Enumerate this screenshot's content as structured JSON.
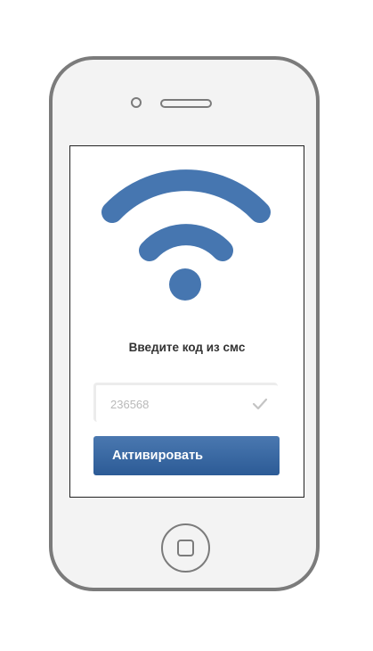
{
  "screen": {
    "prompt": "Введите код из смс",
    "code_field": {
      "value": "236568"
    },
    "activate_button": {
      "label": "Активировать"
    }
  },
  "icons": {
    "main": "wifi-icon",
    "field_status": "checkmark-icon",
    "device_button": "home-button-icon"
  },
  "colors": {
    "accent": "#4676b0",
    "button_top": "#4a78b0",
    "button_bottom": "#2c5b96",
    "device_frame": "#7b7b7b",
    "device_body": "#f3f3f3"
  }
}
